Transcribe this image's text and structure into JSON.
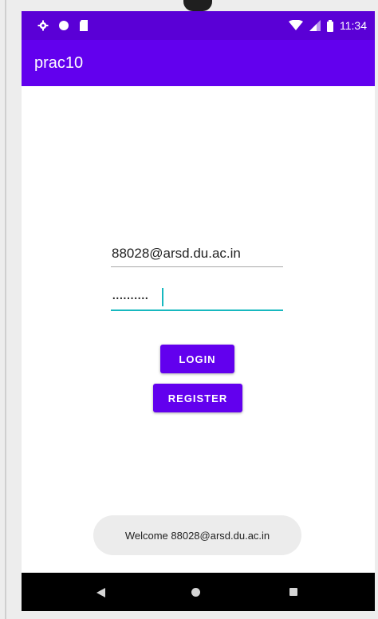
{
  "status_bar": {
    "time": "11:34",
    "left_icons": [
      "gear-icon",
      "circle-icon",
      "sd-card-icon"
    ],
    "right_icons": [
      "wifi-icon",
      "signal-icon",
      "battery-icon"
    ]
  },
  "app_bar": {
    "title": "prac10"
  },
  "form": {
    "email_value": "88028@arsd.du.ac.in",
    "password_value": "..........",
    "login_label": "LOGIN",
    "register_label": "REGISTER"
  },
  "toast": {
    "message": "Welcome 88028@arsd.du.ac.in"
  },
  "nav_bar": {
    "icons": [
      "back-icon",
      "home-icon",
      "recents-icon"
    ]
  },
  "colors": {
    "primary": "#6200ee",
    "status_bar": "#5a00d6",
    "accent": "#17b8bf"
  }
}
